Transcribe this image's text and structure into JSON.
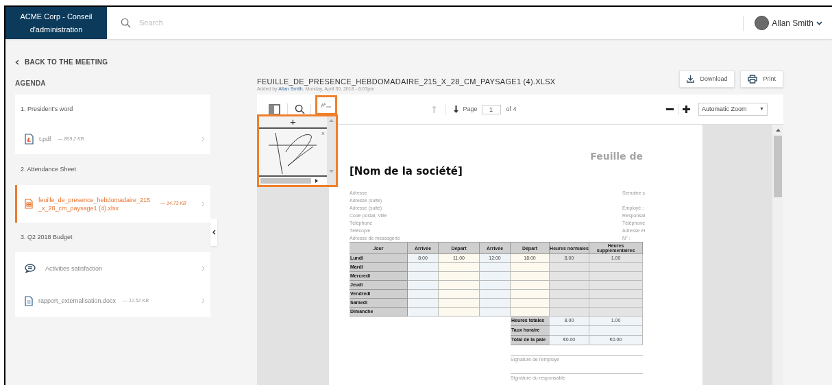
{
  "header": {
    "brand": "ACME Corp - Conseil d'administration",
    "search": {
      "placeholder": "Search"
    },
    "user": {
      "name": "Allan Smith"
    }
  },
  "back_link": "BACK TO THE MEETING",
  "agenda": {
    "title": "AGENDA",
    "items": [
      {
        "kind": "section",
        "label": "1. President's word"
      },
      {
        "kind": "pdf",
        "name": "t.pdf",
        "size": "— 809.2 KB",
        "selected": false
      },
      {
        "kind": "section",
        "label": "2. Attendance Sheet"
      },
      {
        "kind": "sheet",
        "name": "feuille_de_presence_hebdomadaire_215_x_28_cm_paysage1 (4).xlsx",
        "size": "— 14.73 KB",
        "selected": true
      },
      {
        "kind": "section",
        "label": "3. Q2 2018 Budget"
      },
      {
        "kind": "survey",
        "name": "Activities satisfaction",
        "selected": false
      },
      {
        "kind": "doc",
        "name": "rapport_externalisation.docx",
        "size": "— 12.52 KB",
        "selected": false
      }
    ]
  },
  "document": {
    "title": "FEUILLE_DE_PRESENCE_HEBDOMADAIRE_215_X_28_CM_PAYSAGE1 (4).XLSX",
    "added_prefix": "Added by",
    "author": "Allan Smith",
    "added_suffix": ", Monday, April 30, 2018 - 6:07pm"
  },
  "actions": [
    {
      "kind": "download",
      "label": "Download"
    },
    {
      "kind": "print",
      "label": "Print"
    }
  ],
  "viewer": {
    "page_label": "Page",
    "page": "1",
    "page_count": "of 4",
    "zoom": "Automatic Zoom",
    "zoom_caret": "▼",
    "signature_tool_active": true,
    "signature_panel": {
      "add": "+",
      "delete": "×"
    }
  },
  "sheet": {
    "title": "Feuille de",
    "company": "[Nom de la société]",
    "address_lines": [
      "Adresse",
      "Adresse (suite)",
      "Adresse (suite)",
      "Code postal, Ville",
      "Téléphone",
      "Télécopie",
      "Adresse de messagerie"
    ],
    "right_lines": [
      "Semaine s",
      "Employé :",
      "Responsal",
      "Téléphone",
      "Adresse él",
      "N° :"
    ],
    "table": {
      "columns": [
        "Jour",
        "Arrivée",
        "Départ",
        "Arrivée",
        "Départ",
        "Heures normales",
        "Heures supplémentaires"
      ],
      "rows": [
        {
          "day": "Lundi",
          "cells": [
            "8:00",
            "11:00",
            "12:00",
            "18:00",
            "8.00",
            "1.00"
          ]
        },
        {
          "day": "Mardi"
        },
        {
          "day": "Mercredi"
        },
        {
          "day": "Jeudi"
        },
        {
          "day": "Vendredi"
        },
        {
          "day": "Samedi"
        },
        {
          "day": "Dimanche"
        }
      ],
      "totals": [
        {
          "label": "Heures totales",
          "values": [
            "8.00",
            "1.00"
          ]
        },
        {
          "label": "Taux horaire"
        },
        {
          "label": "Total de la paie",
          "values": [
            "€0.00",
            "€0.00"
          ]
        }
      ]
    },
    "signatures": [
      "Signature de l'employé",
      "Signature du responsable"
    ]
  }
}
